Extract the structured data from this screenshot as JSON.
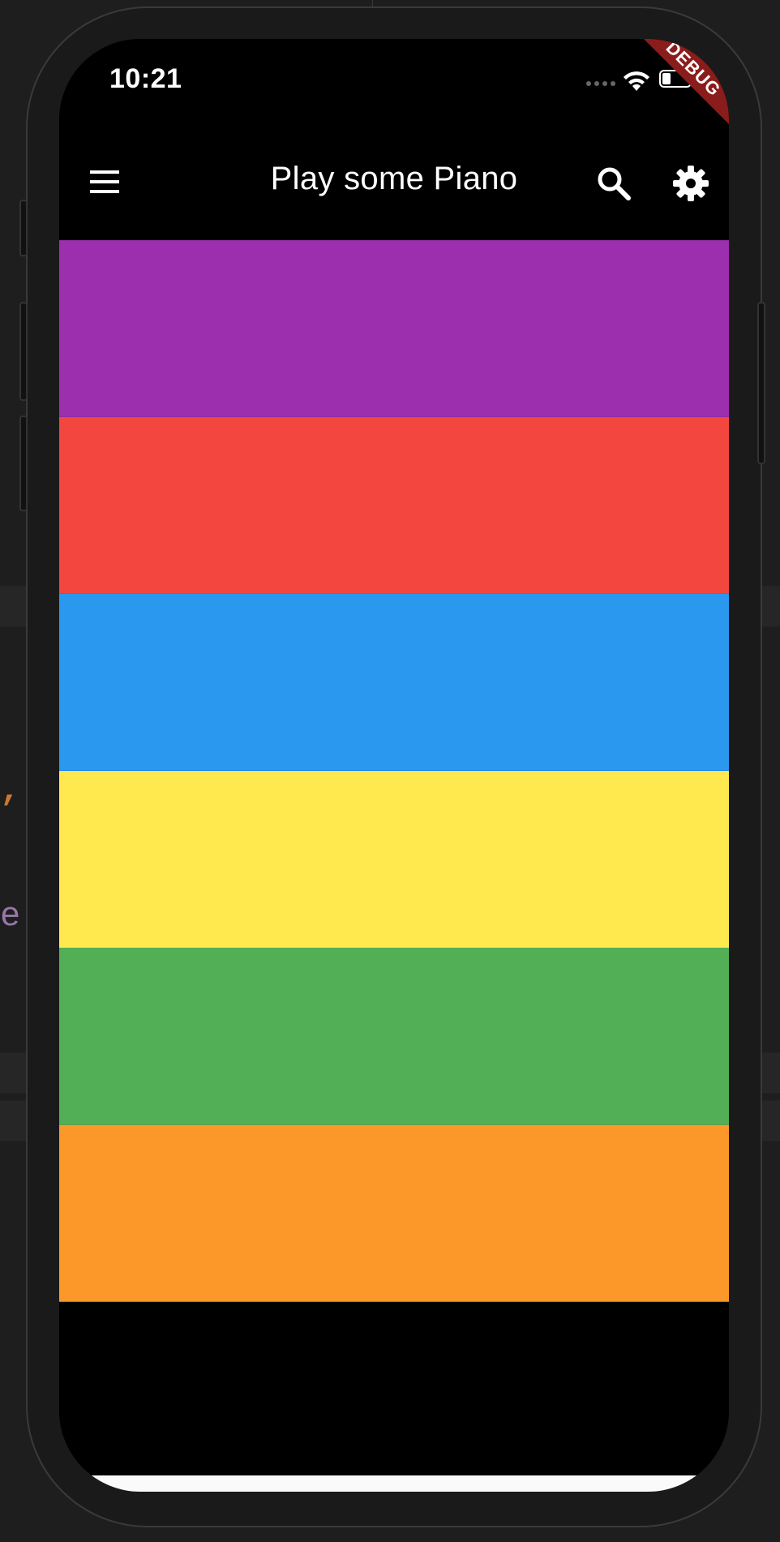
{
  "status_bar": {
    "time": "10:21",
    "debug_label": "DEBUG"
  },
  "app_bar": {
    "title": "Play some Piano",
    "menu_icon": "menu-icon",
    "search_icon": "search-icon",
    "settings_icon": "gear-icon"
  },
  "keys": [
    {
      "name": "purple",
      "color": "#9c2fae"
    },
    {
      "name": "red",
      "color": "#f2463e"
    },
    {
      "name": "blue",
      "color": "#2b98ef"
    },
    {
      "name": "yellow",
      "color": "#ffe94f"
    },
    {
      "name": "green",
      "color": "#52af56"
    },
    {
      "name": "orange",
      "color": "#fc982a"
    }
  ],
  "background_code": {
    "comma": ",",
    "paren": "e)"
  }
}
